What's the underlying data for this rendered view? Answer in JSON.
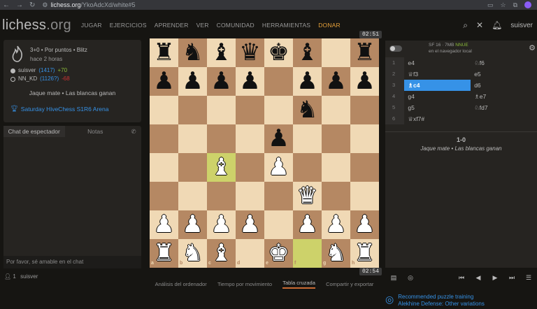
{
  "browser": {
    "url_host": "lichess.org",
    "url_path": "/YkoAdcXd/white#5"
  },
  "header": {
    "logo_main": "lichess",
    "logo_tld": ".org",
    "nav": [
      "JUGAR",
      "EJERCICIOS",
      "APRENDER",
      "VER",
      "COMUNIDAD",
      "HERRAMIENTAS"
    ],
    "donate": "DONAR",
    "username": "suisver"
  },
  "game": {
    "mode": "3+0 • Por puntos • Blitz",
    "ago": "hace 2 horas",
    "white_player": "suisver",
    "white_rating": "(1417)",
    "white_diff": "+70",
    "black_player": "NN_KD",
    "black_rating": "(1126?)",
    "black_diff": "-68",
    "result_text": "Jaque mate • Las blancas ganan",
    "tournament": "Saturday HiveChess S1R6 Arena"
  },
  "chat": {
    "tab_chat": "Chat de espectador",
    "tab_notes": "Notas",
    "placeholder": "Por favor, sé amable en el chat"
  },
  "watchers": {
    "count": "1",
    "name": "suisver"
  },
  "clocks": {
    "top": "02:51",
    "bottom": "02:54"
  },
  "board": {
    "files": [
      "a",
      "b",
      "c",
      "d",
      "e",
      "f",
      "g",
      "h"
    ],
    "ranks": [
      "8",
      "7",
      "6",
      "5",
      "4",
      "3",
      "2",
      "1"
    ],
    "position": [
      [
        "r",
        "n",
        "b",
        "q",
        "k",
        "b",
        "",
        "r"
      ],
      [
        "p",
        "p",
        "p",
        "p",
        "",
        "p",
        "p",
        "p"
      ],
      [
        "",
        "",
        "",
        "",
        "",
        "n",
        "",
        ""
      ],
      [
        "",
        "",
        "",
        "",
        "p",
        "",
        "",
        ""
      ],
      [
        "",
        "",
        "B",
        "",
        "P",
        "",
        "",
        ""
      ],
      [
        "",
        "",
        "",
        "",
        "",
        "Q",
        "",
        ""
      ],
      [
        "P",
        "P",
        "P",
        "P",
        "",
        "P",
        "P",
        "P"
      ],
      [
        "R",
        "N",
        "B",
        "",
        "K",
        "",
        "N",
        "R"
      ]
    ],
    "highlight": [
      [
        4,
        2
      ],
      [
        7,
        5
      ]
    ]
  },
  "under_tabs": [
    "Análisis del ordenador",
    "Tiempo por movimiento",
    "Tabla cruzada",
    "Compartir y exportar"
  ],
  "engine": {
    "name": "SF 16 · 7MB",
    "nnue": "NNUE",
    "location": "en el navegador local"
  },
  "moves": [
    {
      "num": "1",
      "white": "e4",
      "black": "♘f6"
    },
    {
      "num": "2",
      "white": "♕f3",
      "black": "e5"
    },
    {
      "num": "3",
      "white": "♗c4",
      "black": "d6"
    },
    {
      "num": "4",
      "white": "g4",
      "black": "♗e7"
    },
    {
      "num": "5",
      "white": "g5",
      "black": "♘fd7"
    },
    {
      "num": "6",
      "white": "♕xf7#",
      "black": ""
    }
  ],
  "result": {
    "score": "1-0",
    "desc": "Jaque mate • Las blancas ganan"
  },
  "puzzle": {
    "line1": "Recommended puzzle training",
    "line2": "Alekhine Defense: Other variations"
  },
  "colors": {
    "accent": "#3692e7",
    "donate": "#e5a03a",
    "positive": "#8bbb39",
    "negative": "#cc3333"
  }
}
